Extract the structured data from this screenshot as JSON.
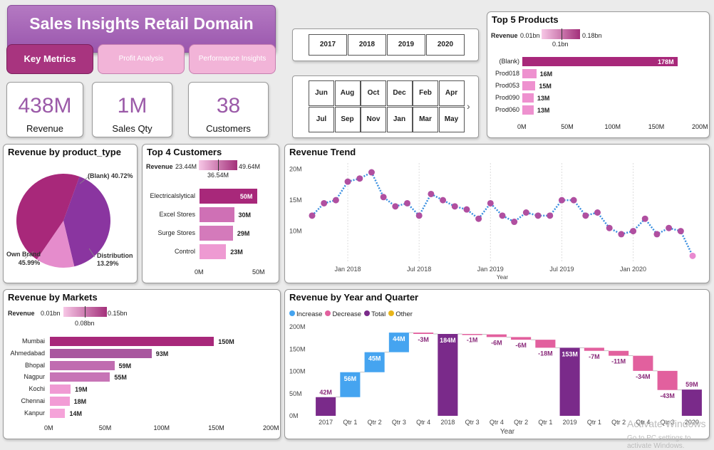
{
  "header": {
    "title": "Sales Insights Retail Domain"
  },
  "tabs": [
    {
      "label": "Key Metrics",
      "active": true
    },
    {
      "label": "Profit Analysis",
      "active": false
    },
    {
      "label": "Performance Insights",
      "active": false
    }
  ],
  "kpis": [
    {
      "value": "438M",
      "label": "Revenue"
    },
    {
      "value": "1M",
      "label": "Sales Qty"
    },
    {
      "value": "38",
      "label": "Customers"
    }
  ],
  "year_slicer": [
    "2017",
    "2018",
    "2019",
    "2020"
  ],
  "month_slicer": [
    "Jun",
    "Aug",
    "Oct",
    "Dec",
    "Feb",
    "Apr",
    "Jul",
    "Sep",
    "Nov",
    "Jan",
    "Mar",
    "May"
  ],
  "top_products": {
    "title": "Top 5 Products",
    "legend": {
      "label": "Revenue",
      "min": "0.01bn",
      "max": "0.18bn",
      "mid": "0.1bn"
    },
    "items": [
      {
        "name": "(Blank)",
        "value": 178,
        "label": "178M"
      },
      {
        "name": "Prod018",
        "value": 16,
        "label": "16M"
      },
      {
        "name": "Prod053",
        "value": 15,
        "label": "15M"
      },
      {
        "name": "Prod090",
        "value": 13,
        "label": "13M"
      },
      {
        "name": "Prod060",
        "value": 13,
        "label": "13M"
      }
    ],
    "axis": [
      "0M",
      "50M",
      "100M",
      "150M",
      "200M"
    ],
    "max": 200
  },
  "product_type": {
    "title": "Revenue by product_type",
    "slices": [
      {
        "name": "(Blank)",
        "pct": 40.72,
        "label": "(Blank) 40.72%",
        "color": "#8a35a0"
      },
      {
        "name": "Distribution",
        "pct": 13.29,
        "label": "Distribution",
        "pct_label": "13.29%",
        "color": "#e58ccc"
      },
      {
        "name": "Own Brand",
        "pct": 45.99,
        "label": "Own Brand",
        "pct_label": "45.99%",
        "color": "#a8287a"
      }
    ]
  },
  "top_customers": {
    "title": "Top 4 Customers",
    "legend": {
      "label": "Revenue",
      "min": "23.44M",
      "max": "49.64M",
      "mid": "36.54M"
    },
    "items": [
      {
        "name": "Electricalslytical",
        "value": 50,
        "label": "50M",
        "color": "#a8287a"
      },
      {
        "name": "Excel Stores",
        "value": 30,
        "label": "30M",
        "color": "#cf70b5"
      },
      {
        "name": "Surge Stores",
        "value": 29,
        "label": "29M",
        "color": "#d47abb"
      },
      {
        "name": "Control",
        "value": 23,
        "label": "23M",
        "color": "#ee9ad2"
      }
    ],
    "axis": [
      "0M",
      "50M"
    ],
    "max": 55
  },
  "revenue_trend": {
    "title": "Revenue Trend",
    "y_ticks": [
      "20M",
      "15M",
      "10M"
    ],
    "x_ticks": [
      "Jan 2018",
      "Jul 2018",
      "Jan 2019",
      "Jul 2019",
      "Jan 2020"
    ],
    "x_label": "Year"
  },
  "markets": {
    "title": "Revenue by Markets",
    "legend": {
      "label": "Revenue",
      "min": "0.01bn",
      "max": "0.15bn",
      "mid": "0.08bn"
    },
    "items": [
      {
        "name": "Mumbai",
        "value": 150,
        "label": "150M",
        "color": "#a8287a"
      },
      {
        "name": "Ahmedabad",
        "value": 93,
        "label": "93M",
        "color": "#a9579f"
      },
      {
        "name": "Bhopal",
        "value": 59,
        "label": "59M",
        "color": "#c06cb0"
      },
      {
        "name": "Nagpur",
        "value": 55,
        "label": "55M",
        "color": "#c774b6"
      },
      {
        "name": "Kochi",
        "value": 19,
        "label": "19M",
        "color": "#f09ad3"
      },
      {
        "name": "Chennai",
        "value": 18,
        "label": "18M",
        "color": "#f29cd5"
      },
      {
        "name": "Kanpur",
        "value": 14,
        "label": "14M",
        "color": "#f5a3d9"
      }
    ],
    "axis": [
      "0M",
      "50M",
      "100M",
      "150M",
      "200M"
    ],
    "max": 200
  },
  "waterfall": {
    "title": "Revenue by Year and Quarter",
    "legend": [
      {
        "label": "Increase",
        "color": "#45a4f0"
      },
      {
        "label": "Decrease",
        "color": "#e2609e"
      },
      {
        "label": "Total",
        "color": "#7a2a8a"
      },
      {
        "label": "Other",
        "color": "#e8b51a"
      }
    ],
    "y_ticks": [
      "200M",
      "150M",
      "100M",
      "50M",
      "0M"
    ],
    "x_label": "Year"
  },
  "chart_data": [
    {
      "type": "line",
      "title": "Revenue Trend",
      "xlabel": "Year",
      "ylabel": "",
      "x": [
        "2017-10",
        "2017-11",
        "2017-12",
        "2018-01",
        "2018-02",
        "2018-03",
        "2018-04",
        "2018-05",
        "2018-06",
        "2018-07",
        "2018-08",
        "2018-09",
        "2018-10",
        "2018-11",
        "2018-12",
        "2019-01",
        "2019-02",
        "2019-03",
        "2019-04",
        "2019-05",
        "2019-06",
        "2019-07",
        "2019-08",
        "2019-09",
        "2019-10",
        "2019-11",
        "2019-12",
        "2020-01",
        "2020-02",
        "2020-03",
        "2020-04",
        "2020-05",
        "2020-06"
      ],
      "y": [
        12.5,
        14.5,
        15,
        18,
        18.5,
        19.5,
        15.5,
        14,
        14.5,
        12.5,
        16,
        15,
        14,
        13.5,
        12,
        14.5,
        12.5,
        11.5,
        13,
        12.5,
        12.5,
        15,
        15,
        12.5,
        13,
        10.5,
        9.5,
        10,
        12,
        9.5,
        10.5,
        10,
        6
      ],
      "ylim": [
        5,
        21
      ],
      "unit": "M"
    },
    {
      "type": "bar",
      "title": "Revenue by Year and Quarter",
      "xlabel": "Year",
      "categories": [
        "2017",
        "Qtr 1",
        "Qtr 2",
        "Qtr 3",
        "Qtr 4",
        "2018",
        "Qtr 3",
        "Qtr 4",
        "Qtr 2",
        "Qtr 1",
        "2019",
        "Qtr 1",
        "Qtr 2",
        "Qtr 4",
        "Qtr 3",
        "2020"
      ],
      "values": [
        42,
        56,
        45,
        44,
        -3,
        184,
        -1,
        -6,
        -6,
        -18,
        153,
        -7,
        -11,
        -34,
        -43,
        59
      ],
      "labels": [
        "42M",
        "56M",
        "45M",
        "44M",
        "-3M",
        "184M",
        "-1M",
        "-6M",
        "-6M",
        "-18M",
        "153M",
        "-7M",
        "-11M",
        "-34M",
        "-43M",
        "59M"
      ],
      "kind": [
        "total",
        "increase",
        "increase",
        "increase",
        "decrease",
        "total",
        "decrease",
        "decrease",
        "decrease",
        "decrease",
        "total",
        "decrease",
        "decrease",
        "decrease",
        "decrease",
        "total"
      ],
      "ylim": [
        0,
        200
      ]
    }
  ],
  "watermark": {
    "line1": "Activate Windows",
    "line2": "Go to PC settings to activate Windows."
  }
}
